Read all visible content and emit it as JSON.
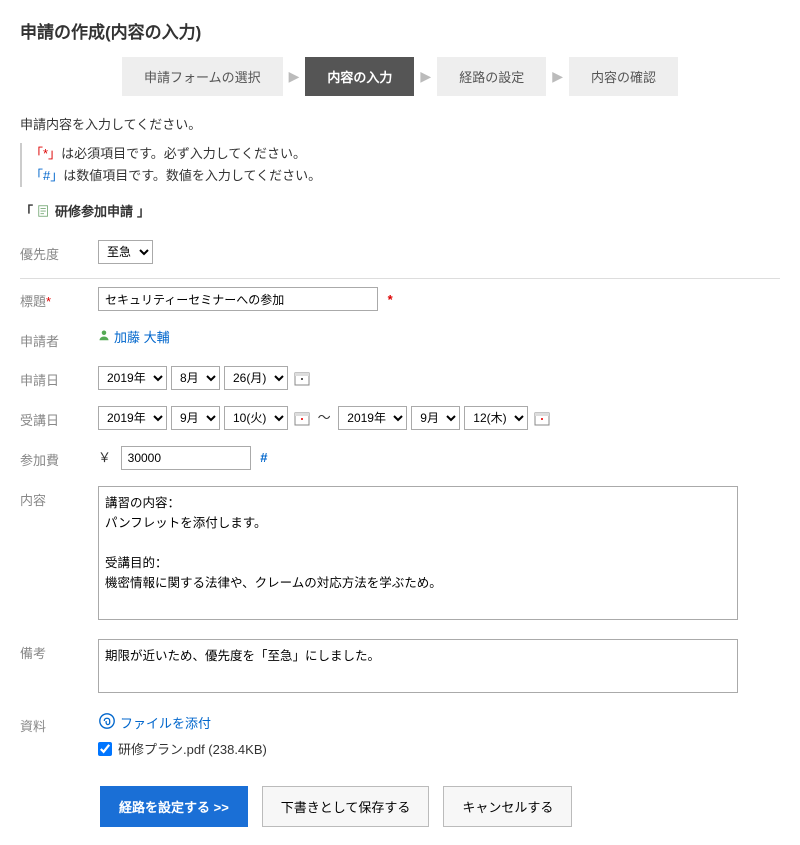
{
  "page_title": "申請の作成(内容の入力)",
  "steps": [
    {
      "label": "申請フォームの選択",
      "active": false
    },
    {
      "label": "内容の入力",
      "active": true
    },
    {
      "label": "経路の設定",
      "active": false
    },
    {
      "label": "内容の確認",
      "active": false
    }
  ],
  "instruction": "申請内容を入力してください。",
  "legend_required": "「*」は必須項目です。必ず入力してください。",
  "legend_numeric": "「#」は数値項目です。数値を入力してください。",
  "form_name_prefix": "「",
  "form_name": "研修参加申請",
  "form_name_suffix": "」",
  "labels": {
    "priority": "優先度",
    "title": "標題",
    "applicant": "申請者",
    "apply_date": "申請日",
    "attend_date": "受講日",
    "fee": "参加費",
    "content": "内容",
    "note": "備考",
    "attachment": "資料"
  },
  "priority_value": "至急",
  "title_value": "セキュリティーセミナーへの参加",
  "applicant_name": "加藤 大輔",
  "apply_date": {
    "year": "2019年",
    "month": "8月",
    "day": "26(月)"
  },
  "attend_start": {
    "year": "2019年",
    "month": "9月",
    "day": "10(火)"
  },
  "attend_end": {
    "year": "2019年",
    "month": "9月",
    "day": "12(木)"
  },
  "tilde": "～",
  "currency": "￥",
  "fee_value": "30000",
  "content_value": "講習の内容：\nパンフレットを添付します。\n\n受講目的：\n機密情報に関する法律や、クレームの対応方法を学ぶため。",
  "note_value": "期限が近いため、優先度を「至急」にしました。",
  "attach_label": "ファイルを添付",
  "attachment_file": "研修プラン.pdf (238.4KB)",
  "buttons": {
    "submit": "経路を設定する >>",
    "draft": "下書きとして保存する",
    "cancel": "キャンセルする"
  }
}
